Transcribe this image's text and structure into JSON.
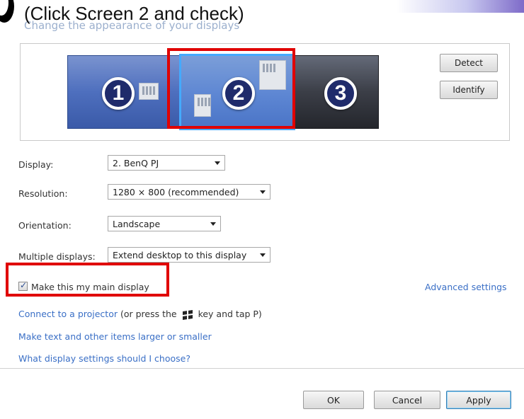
{
  "instruction": "(Click Screen 2 and check)",
  "page_title": "Change the appearance of your displays",
  "monitors": [
    {
      "number": "1"
    },
    {
      "number": "2",
      "selected": true
    },
    {
      "number": "3"
    }
  ],
  "buttons": {
    "detect": "Detect",
    "identify": "Identify",
    "ok": "OK",
    "cancel": "Cancel",
    "apply": "Apply"
  },
  "settings": {
    "display_label": "Display:",
    "display_value": "2. BenQ PJ",
    "resolution_label": "Resolution:",
    "resolution_value": "1280 × 800 (recommended)",
    "orientation_label": "Orientation:",
    "orientation_value": "Landscape",
    "multiple_label": "Multiple displays:",
    "multiple_value": "Extend desktop to this display"
  },
  "main_display": {
    "label": "Make this my main display",
    "checked": true
  },
  "links": {
    "advanced": "Advanced settings",
    "projector_link": "Connect to a projector",
    "projector_text_a": "(or press the",
    "projector_text_b": "key and tap P)",
    "text_size": "Make text and other items larger or smaller",
    "which_settings": "What display settings should I choose?"
  },
  "colors": {
    "highlight_box": "#e00000",
    "link": "#3a6fc6",
    "selected_border": "#44aaff"
  },
  "icons": [
    "windows-key-icon",
    "dropdown-arrow-icon",
    "checkbox-check-icon"
  ]
}
